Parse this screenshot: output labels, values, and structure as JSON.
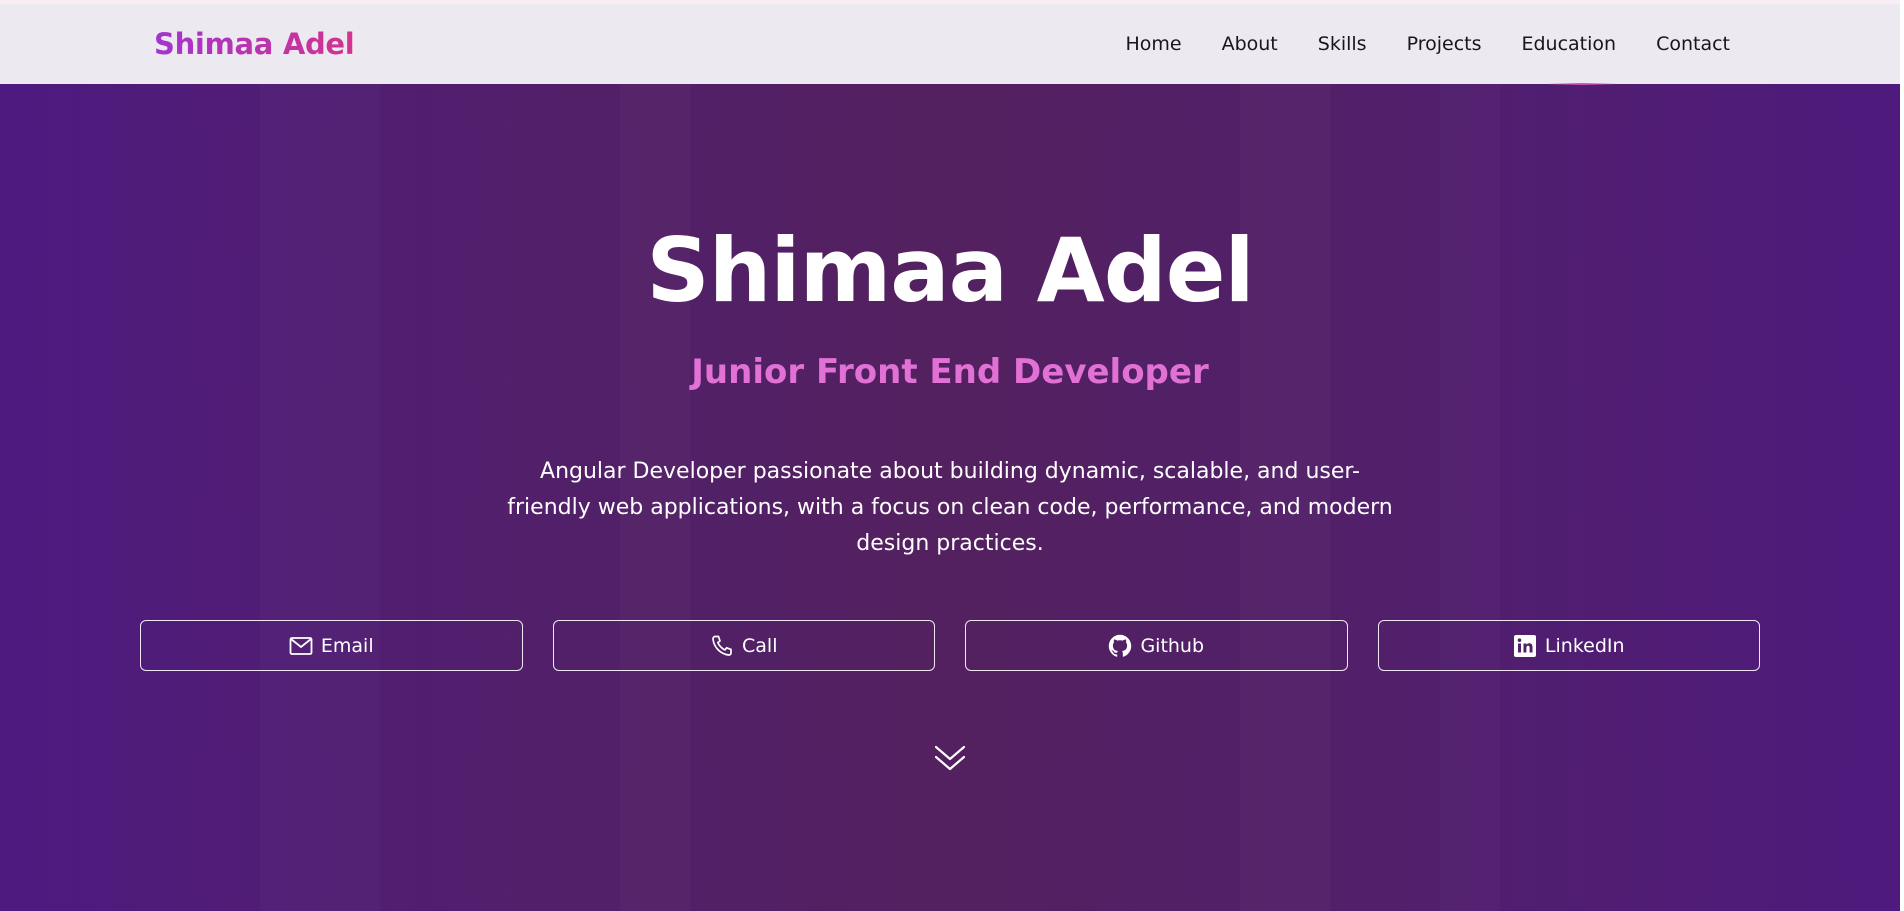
{
  "navbar": {
    "brand": "Shimaa Adel",
    "links": [
      {
        "label": "Home"
      },
      {
        "label": "About"
      },
      {
        "label": "Skills"
      },
      {
        "label": "Projects"
      },
      {
        "label": "Education"
      },
      {
        "label": "Contact"
      }
    ]
  },
  "hero": {
    "name": "Shimaa Adel",
    "role": "Junior Front End Developer",
    "description": "Angular Developer passionate about building dynamic, scalable, and user-friendly web applications, with a focus on clean code, performance, and modern design practices.",
    "actions": [
      {
        "label": "Email",
        "icon": "mail-icon"
      },
      {
        "label": "Call",
        "icon": "phone-icon"
      },
      {
        "label": "Github",
        "icon": "github-icon"
      },
      {
        "label": "LinkedIn",
        "icon": "linkedin-icon"
      }
    ],
    "scroll_icon": "chevron-double-down-icon"
  },
  "colors": {
    "brand_gradient_start": "#a334cf",
    "brand_gradient_end": "#d2338e",
    "navbar_bg": "#ece9f0",
    "hero_bg": "#522069",
    "role_text": "#e271d6",
    "text_light": "#ffffff"
  }
}
